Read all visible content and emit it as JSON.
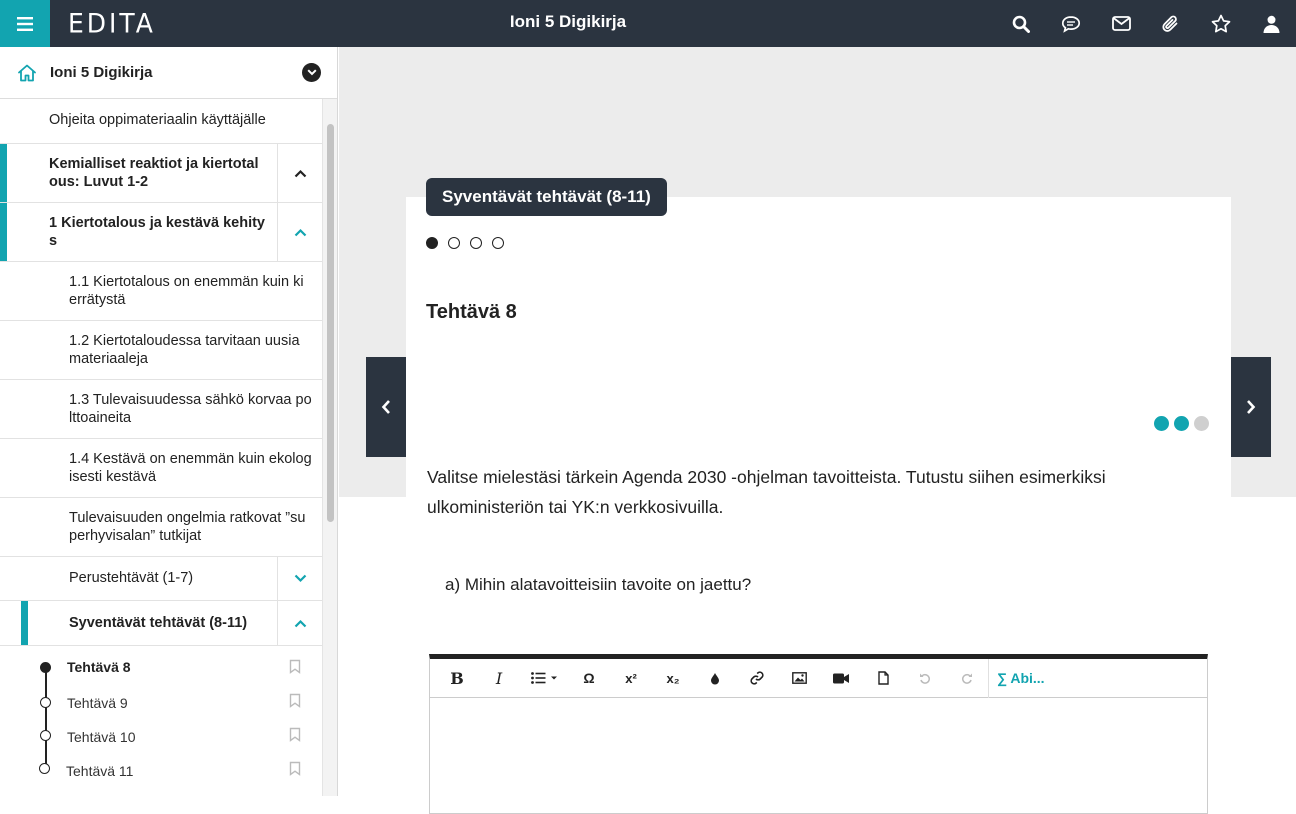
{
  "header": {
    "logo": "EDITA",
    "title": "Ioni 5 Digikirja",
    "icons": [
      "search-icon",
      "chat-icon",
      "mail-icon",
      "paperclip-icon",
      "star-icon",
      "user-icon"
    ]
  },
  "sidebar": {
    "title": "Ioni 5 Digikirja",
    "items": [
      {
        "label": "Ohjeita oppimateriaalin käyttäjälle"
      },
      {
        "label": "Kemialliset reaktiot ja kiertotal ous: Luvut 1-2"
      },
      {
        "label": "1 Kiertotalous ja kestävä kehity s"
      },
      {
        "label": "1.1 Kiertotalous on enemmän kuin ki errätystä"
      },
      {
        "label": "1.2 Kiertotaloudessa tarvitaan uusia materiaaleja"
      },
      {
        "label": "1.3 Tulevaisuudessa sähkö korvaa po lttoaineita"
      },
      {
        "label": "1.4 Kestävä on enemmän kuin ekolog isesti kestävä"
      },
      {
        "label": "Tulevaisuuden ongelmia ratkovat ”su perhyvisalan” tutkijat"
      },
      {
        "label": "Perustehtävät (1-7)"
      },
      {
        "label": "Syventävät tehtävät (8-11)"
      }
    ],
    "tasks": [
      {
        "label": "Tehtävä 8"
      },
      {
        "label": "Tehtävä 9"
      },
      {
        "label": "Tehtävä 10"
      },
      {
        "label": "Tehtävä 11"
      }
    ]
  },
  "main": {
    "section_tag": "Syventävät tehtävät (8-11)",
    "task_title": "Tehtävä 8",
    "body": "Valitse mielestäsi tärkein Agenda 2030 -ohjelman tavoitteista. Tutustu siihen esimerkiksi ulkoministeriön tai YK:n verkkosivuilla.",
    "question": "a) Mihin alatavoitteisiin tavoite on jaettu?",
    "pages": 4,
    "active_page": 1
  },
  "editor": {
    "bold": "B",
    "italic": "I",
    "omega": "Ω",
    "superscript": "x²",
    "subscript": "x₂",
    "abi_label": "∑ Abi..."
  },
  "colors": {
    "accent": "#12a4b0",
    "dark": "#2b3440"
  }
}
